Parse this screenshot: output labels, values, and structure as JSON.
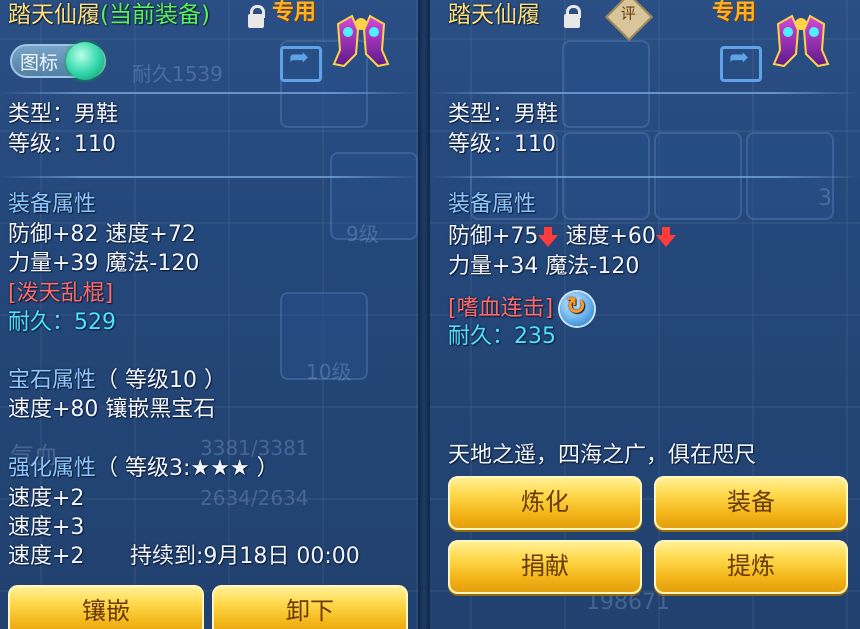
{
  "left": {
    "item_name": "踏天仙履",
    "equipped_note": "(当前装备)",
    "exclusive_tag": "专用",
    "icon_toggle_label": "图标",
    "type_line": "类型：男鞋",
    "level_line": "等级：110",
    "equip_attr_head": "装备属性",
    "attr_line1": "防御+82 速度+72",
    "attr_line2": "力量+39 魔法-120",
    "skill": "[泼天乱棍]",
    "durability": "耐久：529",
    "gem_head": "宝石属性",
    "gem_level": "（ 等级10 ）",
    "gem_line": "速度+80 镶嵌黑宝石",
    "enhance_head": "强化属性",
    "enhance_level": "（ 等级3:★★★ ）",
    "enhance_line1": "速度+2",
    "enhance_line2": "速度+3",
    "enhance_line3": "速度+2",
    "duration": "持续到:9月18日 00:00",
    "btn_inlay": "镶嵌",
    "btn_unequip": "卸下"
  },
  "right": {
    "item_name": "踏天仙履",
    "rate_tag": "评",
    "exclusive_tag": "专用",
    "type_line": "类型：男鞋",
    "level_line": "等级：110",
    "equip_attr_head": "装备属性",
    "defense": "防御+75",
    "speed": "速度+60",
    "attr_line2": "力量+34 魔法-120",
    "skill": "[嗜血连击]",
    "durability": "耐久：235",
    "flavor": "天地之遥，四海之广，俱在咫尺",
    "btn_refine": "炼化",
    "btn_equip": "装备",
    "btn_donate": "捐献",
    "btn_extract": "提炼"
  },
  "background": {
    "ghost_level_a": "10级",
    "ghost_level_b": "9级",
    "ghost_level_c": "10级",
    "ghost_level_d": "10级",
    "ghost_hp": "3381/3381",
    "ghost_mp": "2634/2634",
    "ghost_durable": "耐久1539",
    "ghost_money": "198671",
    "ghost_qi": "气血",
    "ghost_count": "3"
  },
  "colors": {
    "title": "#ffe07a",
    "equipped": "#5cf05c",
    "section_head": "#8ec7ff",
    "skill": "#ff6a6a",
    "durability": "#4fe3ff",
    "button": "#f2b519"
  }
}
